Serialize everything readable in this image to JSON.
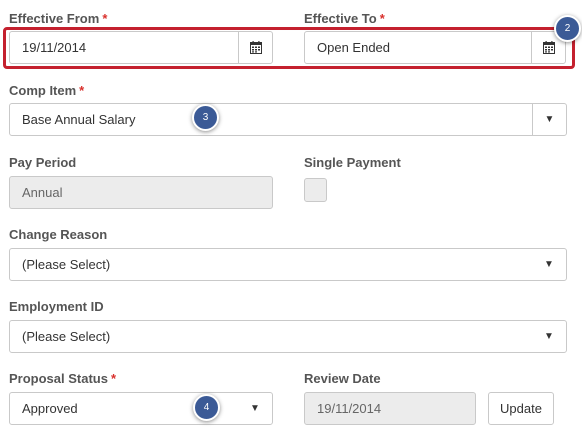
{
  "effective_from": {
    "label": "Effective From",
    "required_mark": "*",
    "value": "19/11/2014",
    "icon": "calendar-icon"
  },
  "effective_to": {
    "label": "Effective To",
    "required_mark": "*",
    "value": "Open Ended",
    "icon": "calendar-icon"
  },
  "comp_item": {
    "label": "Comp Item",
    "required_mark": "*",
    "value": "Base Annual Salary",
    "icon": "caret-down-icon"
  },
  "pay_period": {
    "label": "Pay Period",
    "value": "Annual"
  },
  "single_payment": {
    "label": "Single Payment",
    "checked": false
  },
  "change_reason": {
    "label": "Change Reason",
    "value": "(Please Select)",
    "icon": "caret-down-icon"
  },
  "employment_id": {
    "label": "Employment ID",
    "value": "(Please Select)",
    "icon": "caret-down-icon"
  },
  "proposal_status": {
    "label": "Proposal Status",
    "required_mark": "*",
    "value": "Approved",
    "icon": "caret-down-icon"
  },
  "review_date": {
    "label": "Review Date",
    "value": "19/11/2014"
  },
  "update_button": {
    "label": "Update"
  },
  "annotations": {
    "markers": [
      "2",
      "3",
      "4"
    ],
    "highlight_color": "#c4202e",
    "marker_color": "#3b5a96"
  }
}
